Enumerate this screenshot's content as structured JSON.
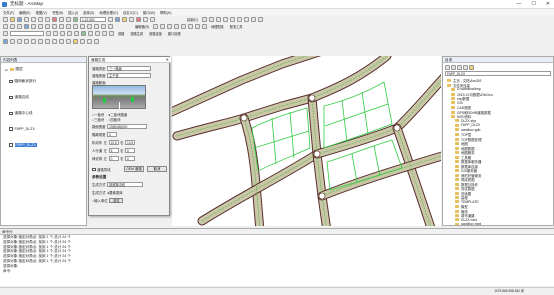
{
  "window": {
    "title": "无标题 - ArcMap",
    "min": "—",
    "max": "☐",
    "close": "✕"
  },
  "menu": [
    "文件(F)",
    "编辑(E)",
    "视图(V)",
    "书签(B)",
    "插入(I)",
    "选择(S)",
    "地理处理(G)",
    "自定义(C)",
    "窗口(W)",
    "帮助(H)"
  ],
  "toolbar1": {
    "scale": "1:12,500",
    "draw_label": "绘制(D)"
  },
  "toolbar2": {
    "editor": "编辑器(R)",
    "labels": [
      "地理配准",
      "配准工具",
      "道路",
      "道路生成",
      "道路连接",
      "路口处理"
    ]
  },
  "toc": {
    "title": "内容列表",
    "layers": [
      "图层",
      "路网面状部分",
      "道路边线",
      "道路中心线",
      "FAPP_DLZX"
    ]
  },
  "dialog": {
    "title": "道路生成",
    "type_label": "道路类型",
    "type_value": "三一路面",
    "width_label": "道路宽度",
    "width_value": "主干道",
    "section_label": "道路断面",
    "radio_labels": [
      "一板块",
      "二板块路面",
      "三板块",
      "四板块"
    ],
    "width_field_label": "路面宽度",
    "width_field_value": "20|5|5|5|5|20",
    "lane_label": "隔离带宽",
    "lane_value": "0",
    "motor_label": "机动车",
    "motor_left": "左",
    "motor_right": "右",
    "motor_lv": "10.5",
    "motor_rv": "10.5",
    "people_label": "人行道",
    "people_lv": "5",
    "people_rv": "5",
    "green_label": "绿化带",
    "green_lv": "0",
    "green_rv": "0",
    "check_label": "道路导线",
    "btn_ok": "OEM 道路",
    "btn_cancel": "取消",
    "params_title": "参数设置",
    "mode_label": "生成方式",
    "mode_value": "按道路中线",
    "output_label": "生成方式",
    "output_opt1": "要素类库",
    "output_opt2": "输入单位",
    "output_btn": "浏览"
  },
  "catalog": {
    "title": "目录",
    "location": "FAPP_DLZX",
    "items": [
      "主页 - 文档\\ArcGIS",
      "文件夹连接",
      "D:\\sandbox\\tmp",
      "2019-12月数据\\ZhbGeo",
      "shp数据",
      "GIS",
      "CAD底图",
      "GPS和RDHB道路数据",
      "MXD资料",
      "DLZX.shp",
      "FAPP_DLZX",
      "sandbox.gdb",
      "TOP层",
      "TOP数据处理",
      "地图",
      "地图数据",
      "地图服务",
      "工具箱",
      "数据库服务器",
      "数据库连接",
      "GIS服务器",
      "我的托管服务",
      "现成底图",
      "数据互操作",
      "测试数据",
      "旧版图",
      "高程",
      "TEMPLATE",
      "模型",
      "管线",
      "城市道路",
      "DLZX.mxd",
      "sandbox.mxd"
    ]
  },
  "command": {
    "title": "命令行",
    "lines": [
      "选择对象:指定对角点: 找到 1 个,总计 24 个",
      "选择对象:指定对角点: 找到 1 个,总计 24 个",
      "选择对象:指定对角点: 找到 1 个,总计 24 个",
      "选择对象:指定对角点: 找到 1 个,总计 24 个",
      "选择对象:指定对角点: 找到 1 个,总计 24 个",
      "选择对象:指定对角点: 找到 1 个,总计 24 个",
      "选择对象:",
      "命令:"
    ]
  },
  "status": {
    "coords": "1075.866  958.182 米"
  },
  "colors": {
    "road_fill": "#c8c8a8",
    "road_edge": "#5a2e2e",
    "centerline": "#6ab04c",
    "parcel": "#2ecc40"
  }
}
